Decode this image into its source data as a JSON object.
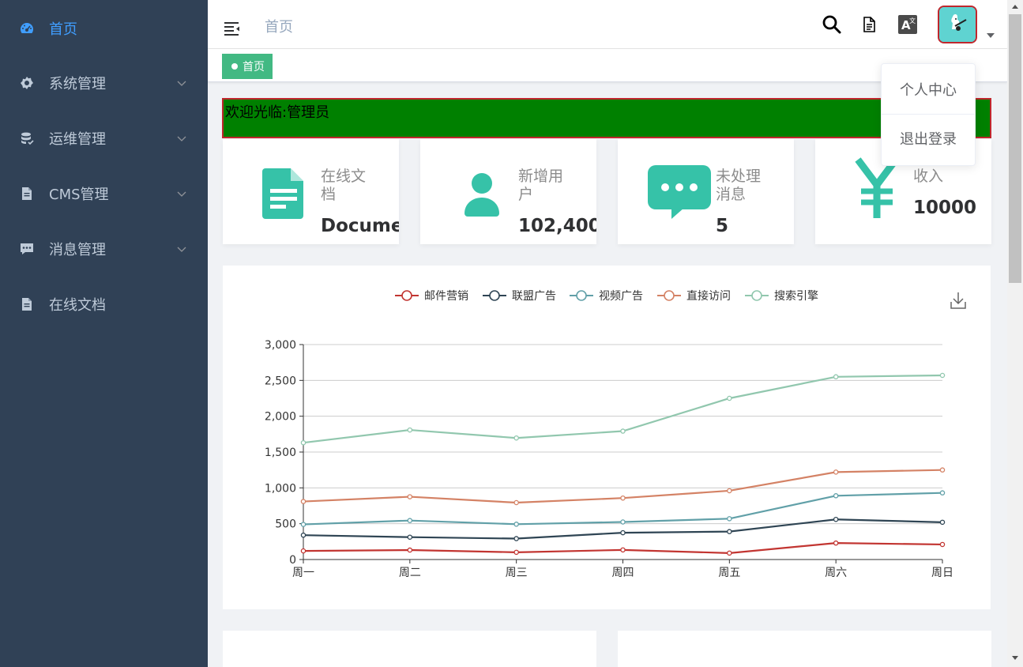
{
  "sidebar": {
    "items": [
      {
        "label": "首页",
        "icon": "dashboard-icon",
        "active": true
      },
      {
        "label": "系统管理",
        "icon": "gear-icon",
        "expandable": true
      },
      {
        "label": "运维管理",
        "icon": "database-icon",
        "expandable": true
      },
      {
        "label": "CMS管理",
        "icon": "document-icon",
        "expandable": true
      },
      {
        "label": "消息管理",
        "icon": "message-icon",
        "expandable": true
      },
      {
        "label": "在线文档",
        "icon": "document-icon"
      }
    ]
  },
  "navbar": {
    "breadcrumb": "首页",
    "icons": [
      "search-icon",
      "document-icon",
      "translate-icon"
    ]
  },
  "tags": [
    {
      "label": "首页",
      "active": true
    }
  ],
  "welcome": "欢迎光临:管理员",
  "cards": [
    {
      "label": "在线文档",
      "value": "Docume",
      "icon": "document-icon"
    },
    {
      "label": "新增用户",
      "value": "102,400",
      "icon": "user-icon"
    },
    {
      "label": "未处理消息",
      "value": "5",
      "icon": "message-icon"
    },
    {
      "label": "收入",
      "value": "10000",
      "icon": "yen-icon"
    }
  ],
  "dropdown": {
    "items": [
      "个人中心",
      "退出登录"
    ]
  },
  "colors": {
    "sidebar_bg": "#304156",
    "accent": "#409eff",
    "tag": "#42b983",
    "card_icon": "#36c2a8",
    "welcome_bg": "#008000"
  },
  "chart_data": {
    "type": "line",
    "categories": [
      "周一",
      "周二",
      "周三",
      "周四",
      "周五",
      "周六",
      "周日"
    ],
    "series": [
      {
        "name": "邮件营销",
        "color": "#c23531",
        "values": [
          120,
          132,
          101,
          134,
          90,
          230,
          210
        ]
      },
      {
        "name": "联盟广告",
        "color": "#2f4554",
        "values": [
          340,
          312,
          292,
          374,
          390,
          560,
          520
        ]
      },
      {
        "name": "视频广告",
        "color": "#61a0a8",
        "values": [
          490,
          544,
          493,
          524,
          570,
          890,
          930
        ]
      },
      {
        "name": "直接访问",
        "color": "#d48265",
        "values": [
          810,
          876,
          794,
          858,
          960,
          1220,
          1250
        ]
      },
      {
        "name": "搜索引擎",
        "color": "#91c7ae",
        "values": [
          1630,
          1808,
          1696,
          1792,
          2250,
          2550,
          2570
        ]
      }
    ],
    "ylim": [
      0,
      3000
    ],
    "yticks": [
      "0",
      "500",
      "1,000",
      "1,500",
      "2,000",
      "2,500",
      "3,000"
    ],
    "grid": true,
    "legend": "top-center",
    "toolbox": "download-icon"
  }
}
